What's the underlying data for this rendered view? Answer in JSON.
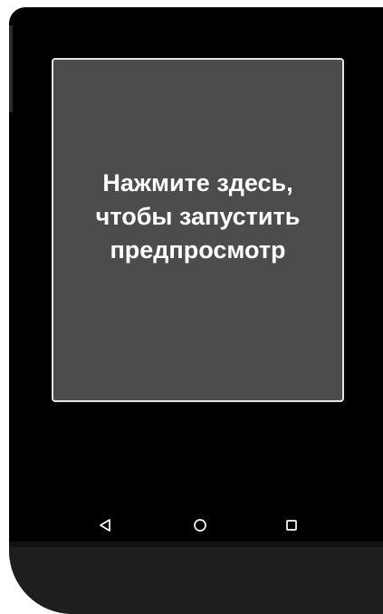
{
  "preview": {
    "text": "Нажмите здесь, чтобы запустить предпросмотр"
  },
  "navigation": {
    "back_icon": "back-triangle-icon",
    "home_icon": "home-circle-icon",
    "recent_icon": "recent-apps-square-icon"
  },
  "colors": {
    "device_body": "#111111",
    "screen": "#000000",
    "preview_background": "#4c4c4c",
    "preview_border": "#e6e6e6",
    "preview_text": "#ffffff",
    "nav_icon": "#ffffff"
  }
}
